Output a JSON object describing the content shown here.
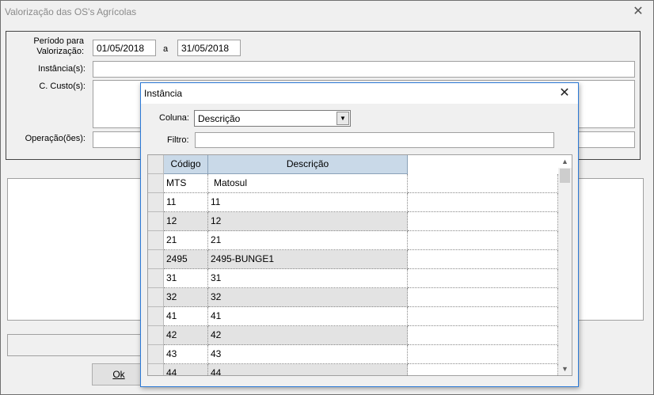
{
  "window": {
    "title": "Valorização das OS's Agrícolas",
    "close": "✕"
  },
  "form": {
    "periodo_label": "Período para\nValorização:",
    "date_from": "01/05/2018",
    "date_sep": "a",
    "date_to": "31/05/2018",
    "instancias_label": "Instância(s):",
    "ccusto_label": "C. Custo(s):",
    "operacoes_label": "Operação(ões):"
  },
  "buttons": {
    "ok_label": "Ok"
  },
  "dialog": {
    "title": "Instância",
    "close": "✕",
    "coluna_label": "Coluna:",
    "coluna_value": "Descrição",
    "filtro_label": "Filtro:",
    "filtro_value": "",
    "columns": [
      "Código",
      "Descrição"
    ],
    "rows": [
      {
        "codigo": "MTS",
        "descricao": "Matosul"
      },
      {
        "codigo": "11",
        "descricao": "11"
      },
      {
        "codigo": "12",
        "descricao": "12"
      },
      {
        "codigo": "21",
        "descricao": "21"
      },
      {
        "codigo": "2495",
        "descricao": "2495-BUNGE1"
      },
      {
        "codigo": "31",
        "descricao": "31"
      },
      {
        "codigo": "32",
        "descricao": "32"
      },
      {
        "codigo": "41",
        "descricao": "41"
      },
      {
        "codigo": "42",
        "descricao": "42"
      },
      {
        "codigo": "43",
        "descricao": "43"
      },
      {
        "codigo": "44",
        "descricao": "44"
      }
    ]
  }
}
